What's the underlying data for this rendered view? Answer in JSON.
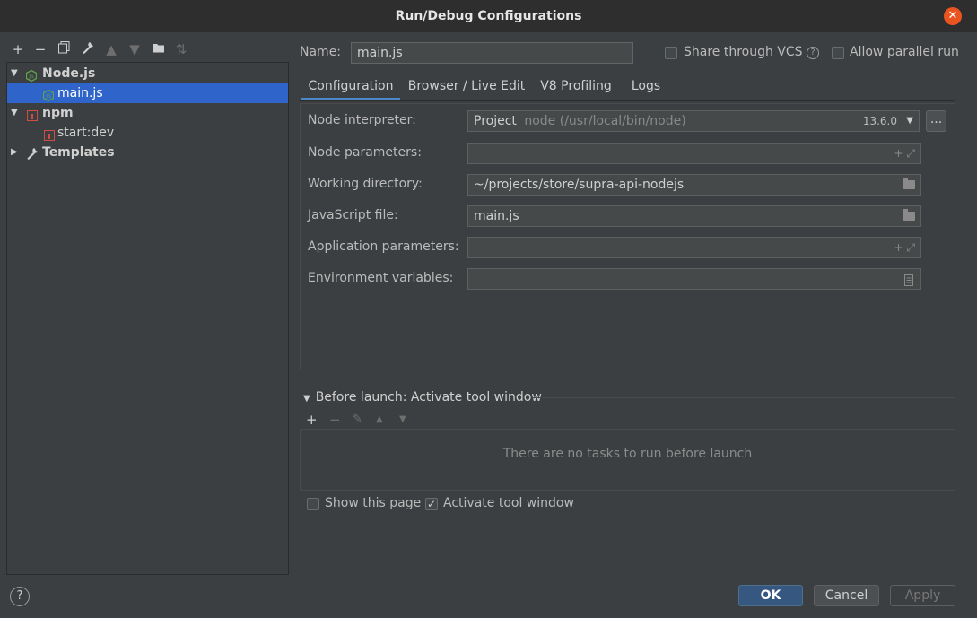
{
  "window": {
    "title": "Run/Debug Configurations"
  },
  "toolbar": {
    "icons": [
      "add-icon",
      "remove-icon",
      "copy-icon",
      "wrench-icon",
      "move-up-icon",
      "move-down-icon",
      "folder-icon",
      "sort-icon"
    ]
  },
  "tree": {
    "items": [
      {
        "label": "Node.js",
        "icon": "nodejs-icon",
        "expanded": true
      },
      {
        "label": "main.js",
        "icon": "nodejs-icon",
        "selected": true
      },
      {
        "label": "npm",
        "icon": "npm-icon",
        "expanded": true
      },
      {
        "label": "start:dev",
        "icon": "npm-icon"
      },
      {
        "label": "Templates",
        "icon": "wrench-icon",
        "expanded": false
      }
    ]
  },
  "name_row": {
    "label": "Name:",
    "value": "main.js",
    "share_vcs": "Share through VCS",
    "allow_parallel": "Allow parallel run"
  },
  "tabs": [
    "Configuration",
    "Browser / Live Edit",
    "V8 Profiling",
    "Logs"
  ],
  "form": {
    "node_interpreter_label": "Node interpreter:",
    "node_interpreter_project": "Project",
    "node_interpreter_path": "node (/usr/local/bin/node)",
    "node_interpreter_version": "13.6.0",
    "browse_label": "...",
    "node_parameters_label": "Node parameters:",
    "node_parameters_value": "",
    "working_directory_label": "Working directory:",
    "working_directory_value": "~/projects/store/supra-api-nodejs",
    "javascript_file_label": "JavaScript file:",
    "javascript_file_value": "main.js",
    "application_parameters_label": "Application parameters:",
    "application_parameters_value": "",
    "environment_variables_label": "Environment variables:",
    "environment_variables_value": ""
  },
  "before_launch": {
    "title": "Before launch: Activate tool window",
    "empty_text": "There are no tasks to run before launch",
    "show_this_page": "Show this page",
    "activate_tool_window": "Activate tool window"
  },
  "buttons": {
    "ok": "OK",
    "cancel": "Cancel",
    "apply": "Apply",
    "help": "?"
  },
  "colors": {
    "accent": "#2f65ca",
    "primary_button": "#365880",
    "close_button": "#e95420",
    "nodejs": "#5fa04e",
    "npm": "#d14d41"
  }
}
